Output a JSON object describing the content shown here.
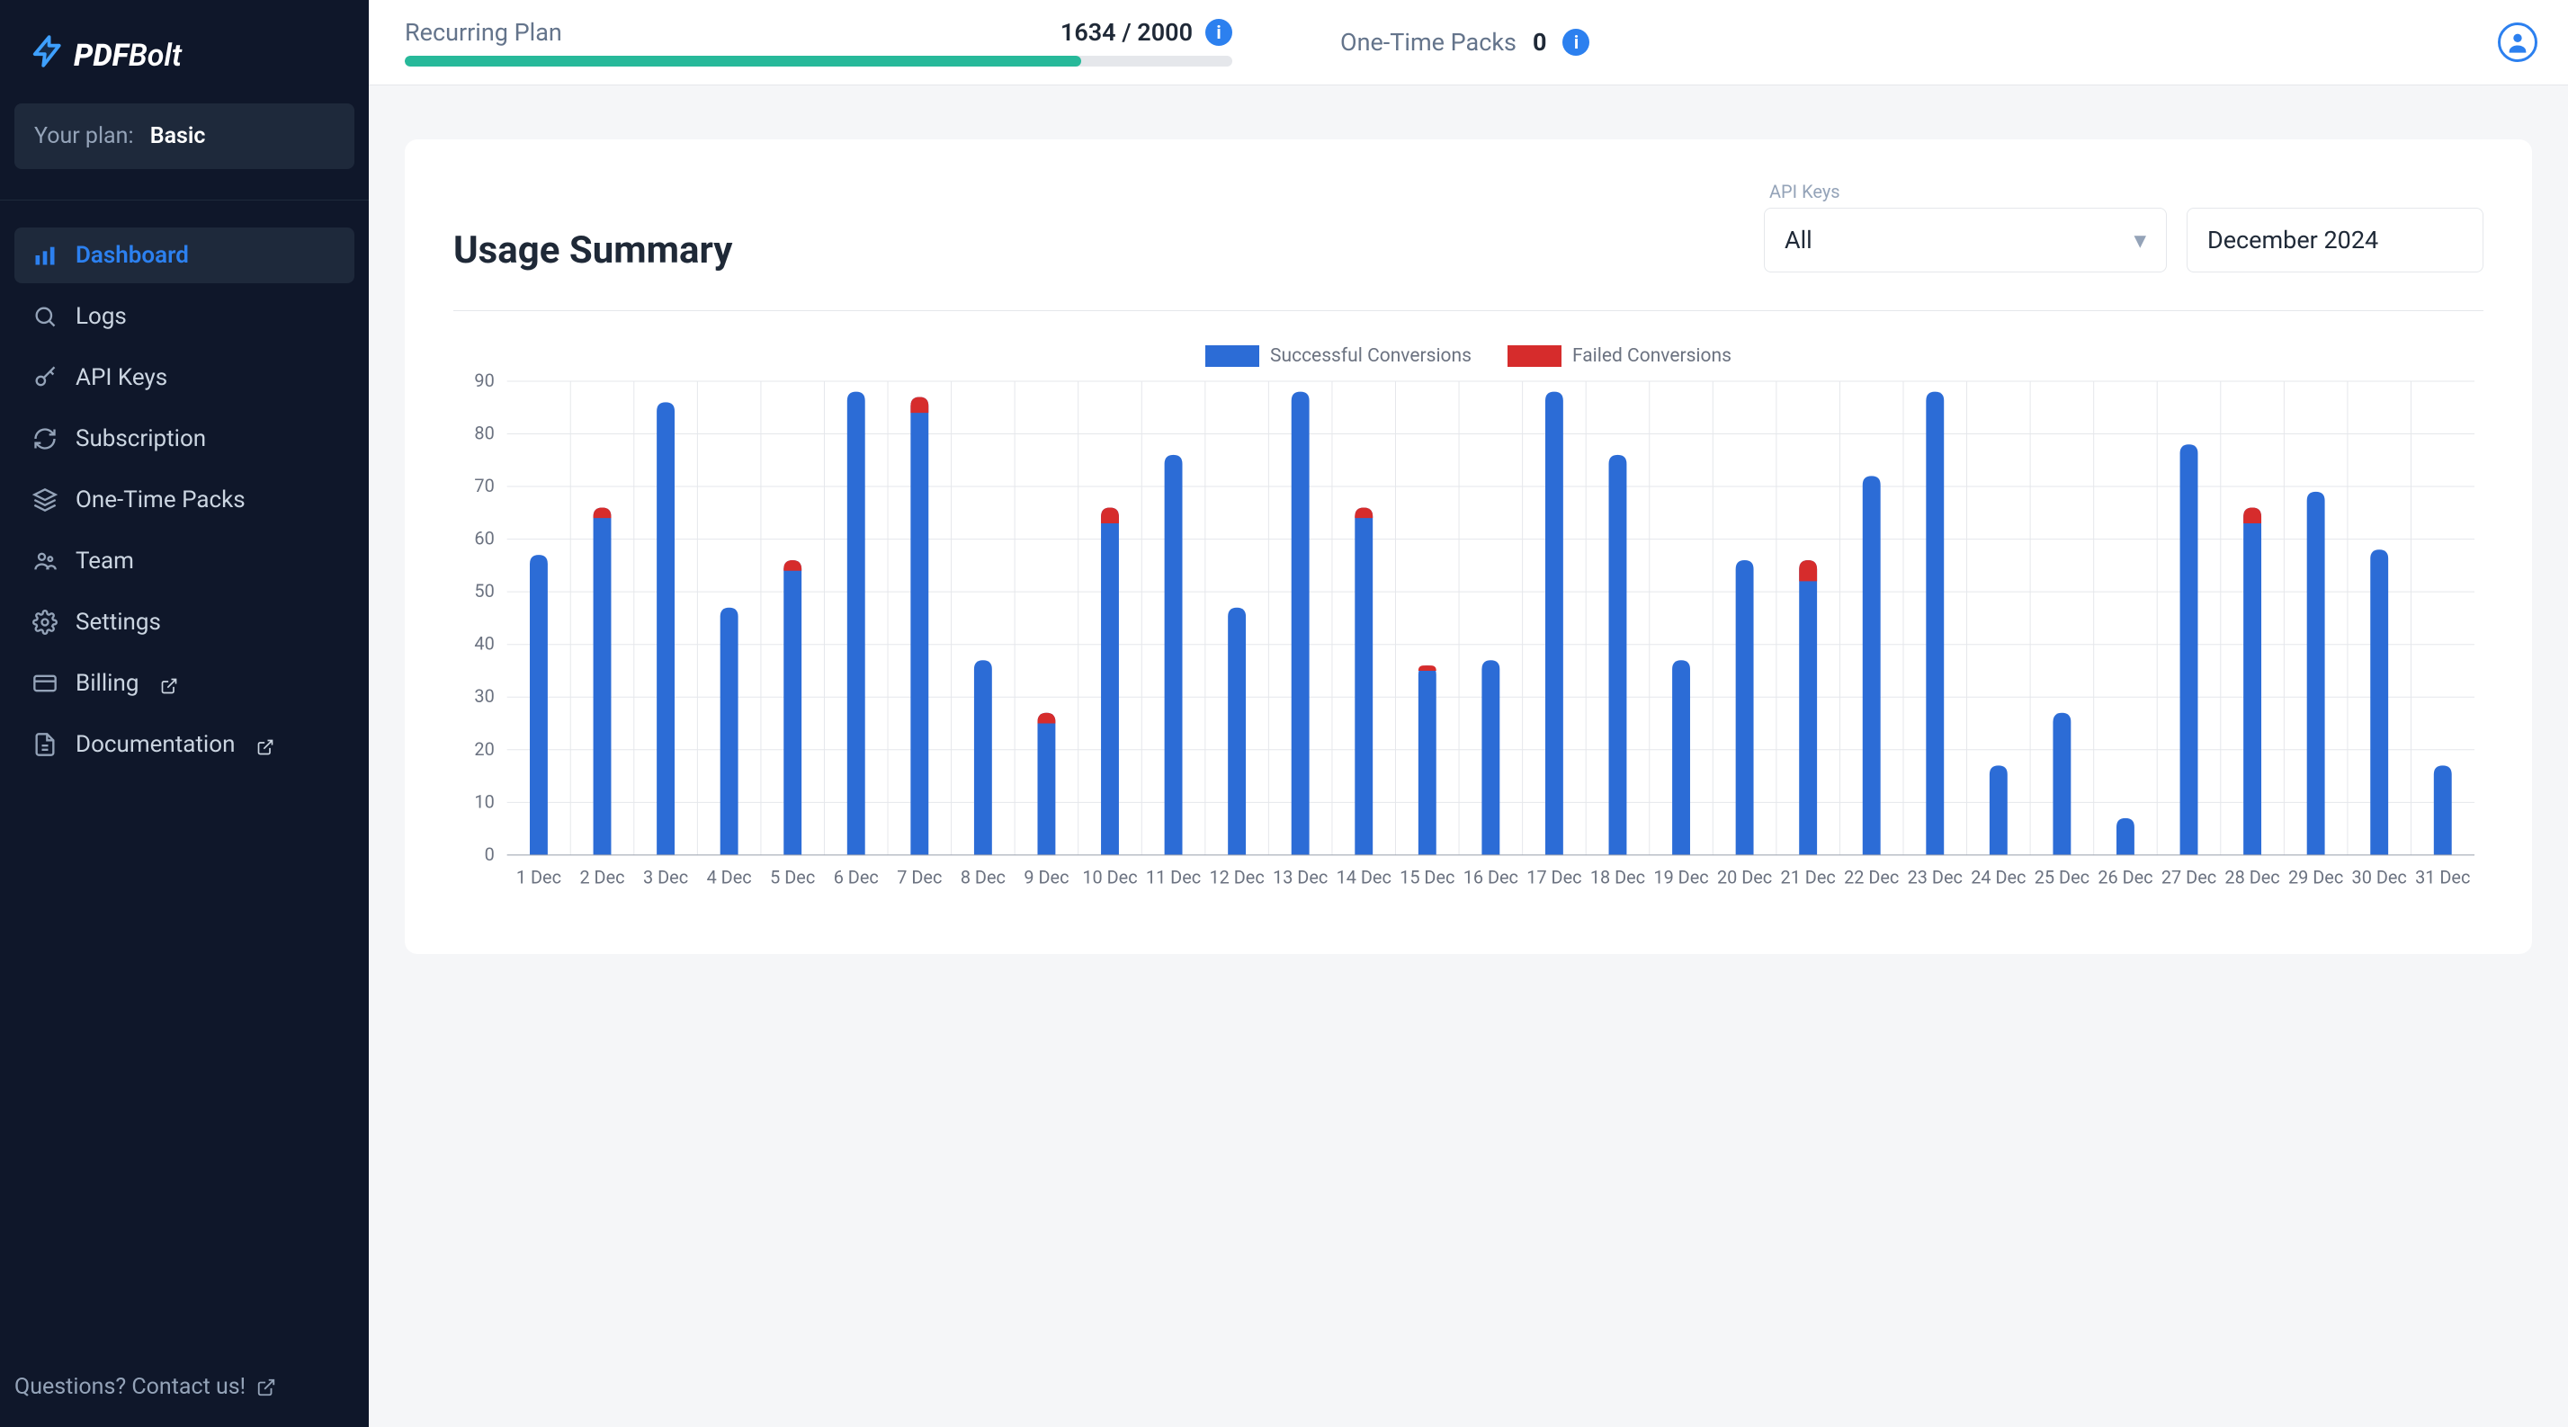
{
  "brand": {
    "pdf": "PDF",
    "bolt": "Bolt"
  },
  "plan": {
    "your_plan_label": "Your plan:",
    "name": "Basic"
  },
  "nav": {
    "dashboard": "Dashboard",
    "logs": "Logs",
    "api_keys": "API Keys",
    "subscription": "Subscription",
    "one_time_packs": "One-Time Packs",
    "team": "Team",
    "settings": "Settings",
    "billing": "Billing",
    "documentation": "Documentation"
  },
  "footer_contact": "Questions? Contact us!",
  "topbar": {
    "recurring_label": "Recurring Plan",
    "recurring_used": 1634,
    "recurring_total": 2000,
    "recurring_display": "1634 / 2000",
    "packs_label": "One-Time Packs",
    "packs_value": "0"
  },
  "card": {
    "title": "Usage Summary",
    "api_keys_label": "API Keys",
    "api_keys_value": "All",
    "date_value": "December 2024"
  },
  "legend": {
    "success": "Successful Conversions",
    "failed": "Failed Conversions"
  },
  "chart_data": {
    "type": "bar",
    "title": "Usage Summary",
    "xlabel": "",
    "ylabel": "",
    "ylim": [
      0,
      90
    ],
    "yticks": [
      0,
      10,
      20,
      30,
      40,
      50,
      60,
      70,
      80,
      90
    ],
    "categories": [
      "1 Dec",
      "2 Dec",
      "3 Dec",
      "4 Dec",
      "5 Dec",
      "6 Dec",
      "7 Dec",
      "8 Dec",
      "9 Dec",
      "10 Dec",
      "11 Dec",
      "12 Dec",
      "13 Dec",
      "14 Dec",
      "15 Dec",
      "16 Dec",
      "17 Dec",
      "18 Dec",
      "19 Dec",
      "20 Dec",
      "21 Dec",
      "22 Dec",
      "23 Dec",
      "24 Dec",
      "25 Dec",
      "26 Dec",
      "27 Dec",
      "28 Dec",
      "29 Dec",
      "30 Dec",
      "31 Dec"
    ],
    "series": [
      {
        "name": "Successful Conversions",
        "color": "#2c6cd6",
        "values": [
          57,
          64,
          86,
          47,
          54,
          88,
          84,
          37,
          25,
          63,
          76,
          47,
          88,
          64,
          35,
          37,
          88,
          76,
          37,
          56,
          52,
          72,
          88,
          17,
          27,
          7,
          78,
          63,
          69,
          58,
          17
        ]
      },
      {
        "name": "Failed Conversions",
        "color": "#d62c2c",
        "values": [
          0,
          2,
          0,
          0,
          2,
          0,
          3,
          0,
          2,
          3,
          0,
          0,
          0,
          2,
          1,
          0,
          0,
          0,
          0,
          0,
          4,
          0,
          0,
          0,
          0,
          0,
          0,
          3,
          0,
          0,
          0
        ]
      }
    ]
  }
}
